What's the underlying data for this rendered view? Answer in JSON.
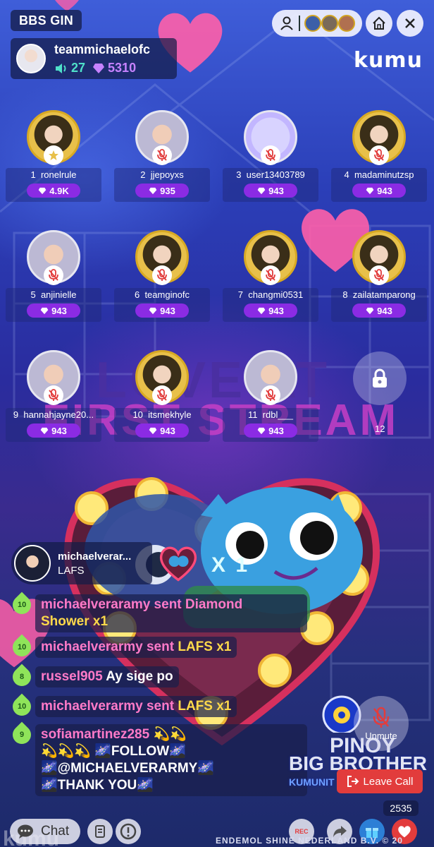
{
  "room": {
    "title": "BBS GIN"
  },
  "host": {
    "name": "teammichaelofc",
    "listeners": "27",
    "gems": "5310"
  },
  "brand": "kumu",
  "seats": [
    {
      "num": "1",
      "name": "ronelrule",
      "gems": "4.9K",
      "avatar": "gold",
      "muted": false
    },
    {
      "num": "2",
      "name": "jjepoyxs",
      "gems": "935",
      "avatar": "photo",
      "muted": true
    },
    {
      "num": "3",
      "name": "user13403789",
      "gems": "943",
      "avatar": "robot",
      "muted": true
    },
    {
      "num": "4",
      "name": "madaminutzsp",
      "gems": "943",
      "avatar": "gold",
      "muted": true
    },
    {
      "num": "5",
      "name": "anjinielle",
      "gems": "943",
      "avatar": "photo",
      "muted": true
    },
    {
      "num": "6",
      "name": "teamginofc",
      "gems": "943",
      "avatar": "gold",
      "muted": true
    },
    {
      "num": "7",
      "name": "changmi0531",
      "gems": "943",
      "avatar": "gold",
      "muted": true
    },
    {
      "num": "8",
      "name": "zailatamparong",
      "gems": "943",
      "avatar": "gold",
      "muted": true
    },
    {
      "num": "9",
      "name": "hannahjayne20...",
      "gems": "943",
      "avatar": "photo",
      "muted": true
    },
    {
      "num": "10",
      "name": "itsmekhyle",
      "gems": "943",
      "avatar": "gold",
      "muted": true
    },
    {
      "num": "11",
      "name": "rdbl___",
      "gems": "943",
      "avatar": "photo",
      "muted": true
    }
  ],
  "locked_seat": {
    "num": "12"
  },
  "overlay": {
    "line1": "LOVE AT",
    "line2": "FIRST STREAM"
  },
  "gift": {
    "user": "michaelverar...",
    "name": "LAFS",
    "multiplier": "X 1"
  },
  "chat": [
    {
      "level": "10",
      "parts": [
        {
          "text": "michaelveraramy sent Diamond",
          "color": "pink"
        },
        {
          "text": "Shower x1",
          "color": "yellow"
        }
      ]
    },
    {
      "level": "10",
      "parts": [
        {
          "text": "michaelverarmy sent ",
          "color": "pink"
        },
        {
          "text": "LAFS x1",
          "color": "yellow"
        }
      ]
    },
    {
      "level": "8",
      "parts": [
        {
          "text": "russel905 ",
          "color": "pink"
        },
        {
          "text": "Ay sige po",
          "color": "white"
        }
      ]
    },
    {
      "level": "10",
      "parts": [
        {
          "text": "michaelverarmy sent ",
          "color": "pink"
        },
        {
          "text": "LAFS x1",
          "color": "yellow"
        }
      ]
    },
    {
      "level": "9",
      "lines": [
        "sofiamartinez285 💫💫",
        "💫💫💫 🌌FOLLOW🌌",
        "🌌@MICHAELVERARMY🌌",
        "🌌THANK YOU🌌"
      ]
    }
  ],
  "controls": {
    "unmute": "Unmute",
    "leave_call": "Leave Call",
    "viewer_count": "2535",
    "chat_label": "Chat",
    "rec": "REC"
  },
  "pbb": {
    "line1": "PINOY",
    "line2": "BIG BROTHER",
    "line3": "KUMUNIT"
  },
  "footer": {
    "credit": "ENDEMOL SHINE NEDERLAND B.V. © 20",
    "watermark": "kumu"
  },
  "colors": {
    "gem_purple": "#8b2be4",
    "leave_red": "#e23c3c",
    "listen_teal": "#4fe0c9",
    "heart_pink": "#ff5fa8"
  }
}
